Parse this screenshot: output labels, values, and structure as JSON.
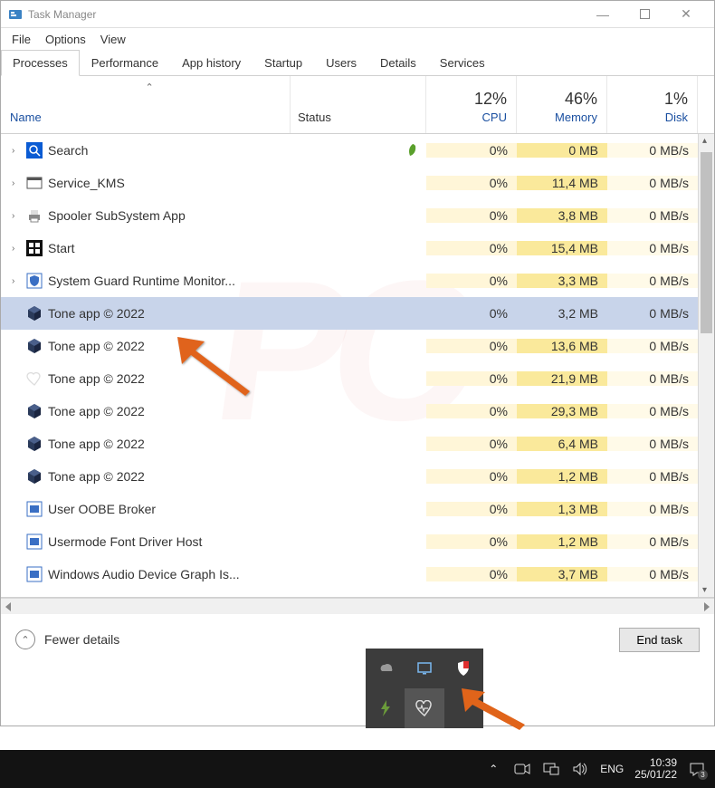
{
  "title": "Task Manager",
  "menu": {
    "file": "File",
    "options": "Options",
    "view": "View"
  },
  "tabs": [
    "Processes",
    "Performance",
    "App history",
    "Startup",
    "Users",
    "Details",
    "Services"
  ],
  "active_tab": 0,
  "columns": {
    "name": "Name",
    "status": "Status",
    "cpu_pct": "12%",
    "cpu": "CPU",
    "mem_pct": "46%",
    "mem": "Memory",
    "disk_pct": "1%",
    "disk": "Disk"
  },
  "rows": [
    {
      "name": "Search",
      "chev": true,
      "icon": "search-blue",
      "status_icon": "leaf",
      "cpu": "0%",
      "mem": "0 MB",
      "disk": "0 MB/s"
    },
    {
      "name": "Service_KMS",
      "chev": true,
      "icon": "window",
      "cpu": "0%",
      "mem": "11,4 MB",
      "disk": "0 MB/s"
    },
    {
      "name": "Spooler SubSystem App",
      "chev": true,
      "icon": "printer",
      "cpu": "0%",
      "mem": "3,8 MB",
      "disk": "0 MB/s"
    },
    {
      "name": "Start",
      "chev": true,
      "icon": "start",
      "cpu": "0%",
      "mem": "15,4 MB",
      "disk": "0 MB/s"
    },
    {
      "name": "System Guard Runtime Monitor...",
      "chev": true,
      "icon": "shield-box",
      "cpu": "0%",
      "mem": "3,3 MB",
      "disk": "0 MB/s"
    },
    {
      "name": "Tone app © 2022",
      "icon": "cube",
      "cpu": "0%",
      "mem": "3,2 MB",
      "disk": "0 MB/s",
      "selected": true
    },
    {
      "name": "Tone app © 2022",
      "icon": "cube",
      "cpu": "0%",
      "mem": "13,6 MB",
      "disk": "0 MB/s"
    },
    {
      "name": "Tone app © 2022",
      "icon": "heart-faint",
      "cpu": "0%",
      "mem": "21,9 MB",
      "disk": "0 MB/s"
    },
    {
      "name": "Tone app © 2022",
      "icon": "cube",
      "cpu": "0%",
      "mem": "29,3 MB",
      "disk": "0 MB/s"
    },
    {
      "name": "Tone app © 2022",
      "icon": "cube",
      "cpu": "0%",
      "mem": "6,4 MB",
      "disk": "0 MB/s"
    },
    {
      "name": "Tone app © 2022",
      "icon": "cube",
      "cpu": "0%",
      "mem": "1,2 MB",
      "disk": "0 MB/s"
    },
    {
      "name": "User OOBE Broker",
      "icon": "window-box",
      "cpu": "0%",
      "mem": "1,3 MB",
      "disk": "0 MB/s"
    },
    {
      "name": "Usermode Font Driver Host",
      "icon": "window-box",
      "cpu": "0%",
      "mem": "1,2 MB",
      "disk": "0 MB/s"
    },
    {
      "name": "Windows Audio Device Graph Is...",
      "icon": "window-box",
      "cpu": "0%",
      "mem": "3,7 MB",
      "disk": "0 MB/s"
    }
  ],
  "footer": {
    "fewer": "Fewer details",
    "endtask": "End task"
  },
  "taskbar": {
    "lang": "ENG",
    "time": "10:39",
    "date": "25/01/22",
    "notif_count": "3"
  }
}
